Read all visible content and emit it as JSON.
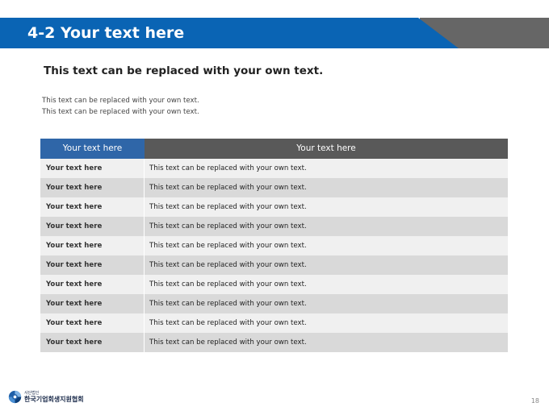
{
  "header": {
    "title": "4-2 Your text here"
  },
  "subtitle": "This text can be replaced with your own text.",
  "description": [
    "This text can be replaced with your own text.",
    "This text can be replaced with your own text."
  ],
  "table": {
    "headers": [
      "Your text here",
      "Your text here"
    ],
    "rows": [
      [
        "Your text here",
        "This text can be replaced with your own text."
      ],
      [
        "Your text here",
        "This text can be replaced with your own text."
      ],
      [
        "Your text here",
        "This text can be replaced with your own text."
      ],
      [
        "Your text here",
        "This text can be replaced with your own text."
      ],
      [
        "Your text here",
        "This text can be replaced with your own text."
      ],
      [
        "Your text here",
        "This text can be replaced with your own text."
      ],
      [
        "Your text here",
        "This text can be replaced with your own text."
      ],
      [
        "Your text here",
        "This text can be replaced with your own text."
      ],
      [
        "Your text here",
        "This text can be replaced with your own text."
      ],
      [
        "Your text here",
        "This text can be replaced with your own text."
      ]
    ]
  },
  "footer": {
    "logo_sub": "사단법인",
    "logo_main": "한국기업회생지원협회",
    "page_number": "18"
  },
  "colors": {
    "header_blue": "#0a64b4",
    "header_gray": "#666666",
    "table_head_left": "#2f66a8",
    "table_head_right": "#595959",
    "row_light": "#f0f0f0",
    "row_dark": "#d9d9d9"
  },
  "icons": {
    "logo": "swirl-emblem-icon"
  }
}
